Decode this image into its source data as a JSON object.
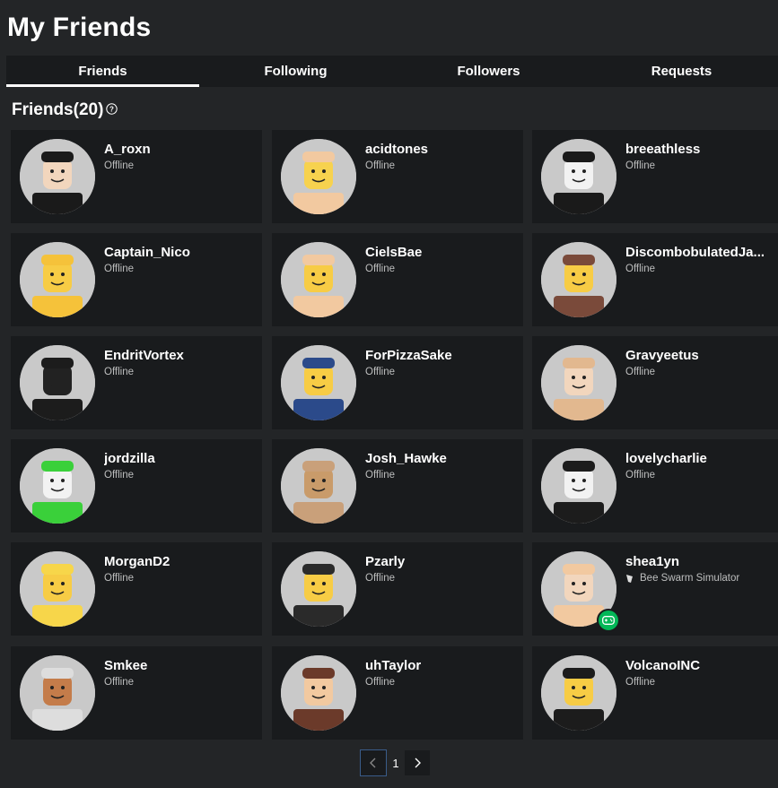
{
  "page": {
    "title": "My Friends"
  },
  "tabs": [
    {
      "label": "Friends",
      "active": true
    },
    {
      "label": "Following",
      "active": false
    },
    {
      "label": "Followers",
      "active": false
    },
    {
      "label": "Requests",
      "active": false
    }
  ],
  "section": {
    "title": "Friends(20)"
  },
  "colors": {
    "background": "#232527",
    "card": "#191b1d",
    "badge_green": "#02b757",
    "status_text": "#bdbebe"
  },
  "friends": [
    {
      "name": "A_roxn",
      "status": "Offline"
    },
    {
      "name": "acidtones",
      "status": "Offline"
    },
    {
      "name": "breeathless",
      "status": "Offline"
    },
    {
      "name": "Captain_Nico",
      "status": "Offline"
    },
    {
      "name": "CielsBae",
      "status": "Offline"
    },
    {
      "name": "DiscombobulatedJa...",
      "status": "Offline"
    },
    {
      "name": "EndritVortex",
      "status": "Offline"
    },
    {
      "name": "ForPizzaSake",
      "status": "Offline"
    },
    {
      "name": "Gravyeetus",
      "status": "Offline"
    },
    {
      "name": "jordzilla",
      "status": "Offline"
    },
    {
      "name": "Josh_Hawke",
      "status": "Offline"
    },
    {
      "name": "lovelycharlie",
      "status": "Offline"
    },
    {
      "name": "MorganD2",
      "status": "Offline"
    },
    {
      "name": "Pzarly",
      "status": "Offline"
    },
    {
      "name": "shea1yn",
      "status": "Bee Swarm Simulator",
      "in_game": true
    },
    {
      "name": "Smkee",
      "status": "Offline"
    },
    {
      "name": "uhTaylor",
      "status": "Offline"
    },
    {
      "name": "VolcanoINC",
      "status": "Offline"
    }
  ],
  "pagination": {
    "current_page": "1",
    "prev_icon": "chevron-left-icon",
    "next_icon": "chevron-right-icon"
  }
}
